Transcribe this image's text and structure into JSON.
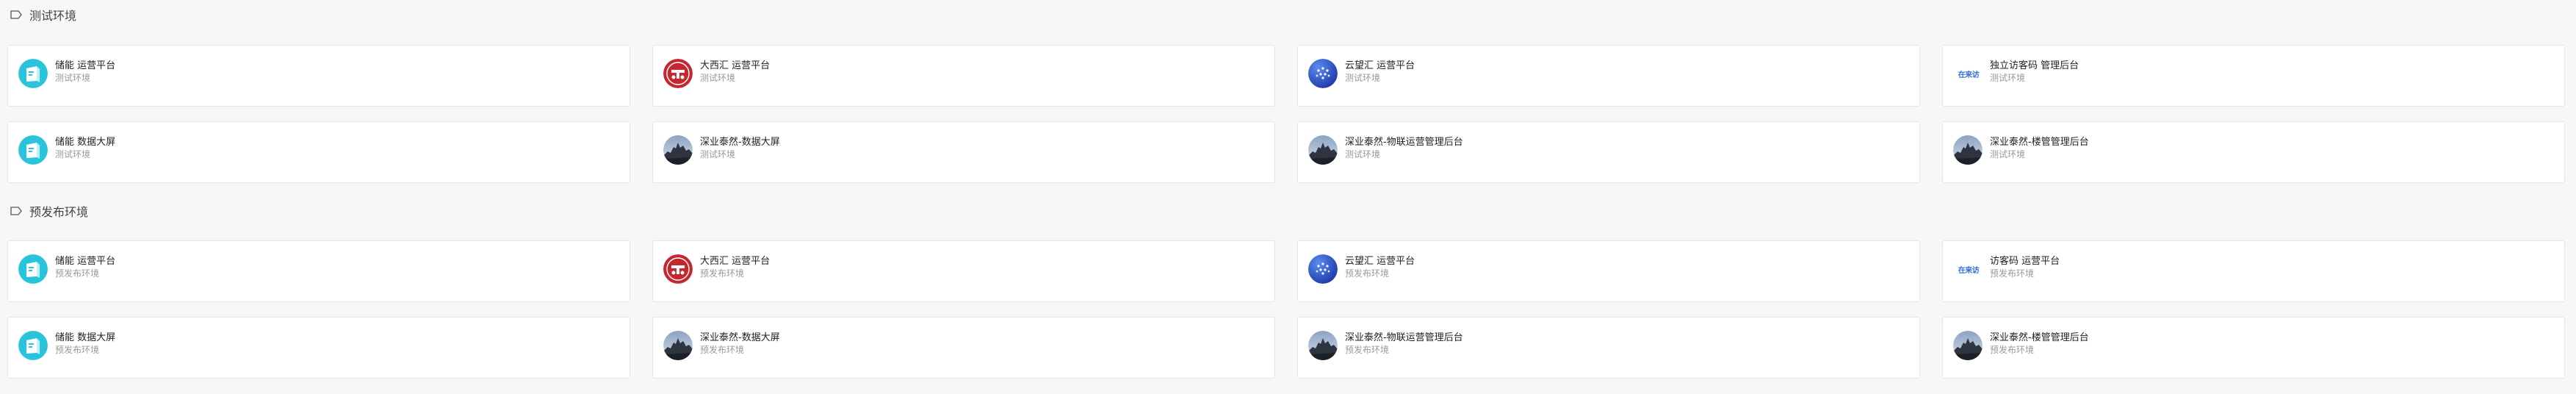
{
  "sections": [
    {
      "title": "测试环境",
      "cards": [
        {
          "title": "储能 运营平台",
          "subtitle": "测试环境",
          "logo": "storage-logo"
        },
        {
          "title": "大西汇 运营平台",
          "subtitle": "测试环境",
          "logo": "daxihui-logo"
        },
        {
          "title": "云望汇 运营平台",
          "subtitle": "测试环境",
          "logo": "yunwanghui-logo"
        },
        {
          "title": "独立访客码 管理后台",
          "subtitle": "测试环境",
          "logo": "visitor-code-logo",
          "logo_text": "在来访"
        },
        {
          "title": "储能 数据大屏",
          "subtitle": "测试环境",
          "logo": "storage-logo"
        },
        {
          "title": "深业泰然-数据大屏",
          "subtitle": "测试环境",
          "logo": "building-photo-logo"
        },
        {
          "title": "深业泰然-物联运营管理后台",
          "subtitle": "测试环境",
          "logo": "building-photo-logo"
        },
        {
          "title": "深业泰然-楼管管理后台",
          "subtitle": "测试环境",
          "logo": "building-photo-logo"
        }
      ]
    },
    {
      "title": "预发布环境",
      "cards": [
        {
          "title": "储能 运营平台",
          "subtitle": "预发布环境",
          "logo": "storage-logo"
        },
        {
          "title": "大西汇 运营平台",
          "subtitle": "预发布环境",
          "logo": "daxihui-logo"
        },
        {
          "title": "云望汇 运营平台",
          "subtitle": "预发布环境",
          "logo": "yunwanghui-logo"
        },
        {
          "title": "访客码 运营平台",
          "subtitle": "预发布环境",
          "logo": "visitor-code-logo",
          "logo_text": "在来访"
        },
        {
          "title": "储能 数据大屏",
          "subtitle": "预发布环境",
          "logo": "storage-logo"
        },
        {
          "title": "深业泰然-数据大屏",
          "subtitle": "预发布环境",
          "logo": "building-photo-logo"
        },
        {
          "title": "深业泰然-物联运营管理后台",
          "subtitle": "预发布环境",
          "logo": "building-photo-logo"
        },
        {
          "title": "深业泰然-楼管管理后台",
          "subtitle": "预发布环境",
          "logo": "building-photo-logo"
        }
      ]
    }
  ],
  "colors": {
    "background": "#f7f7f7",
    "card": "#ffffff",
    "storage": "#29c3dc",
    "daxihui": "#c6262e",
    "yunwanghui": "#2a4fc9",
    "visitor": "#2f6fd6"
  }
}
